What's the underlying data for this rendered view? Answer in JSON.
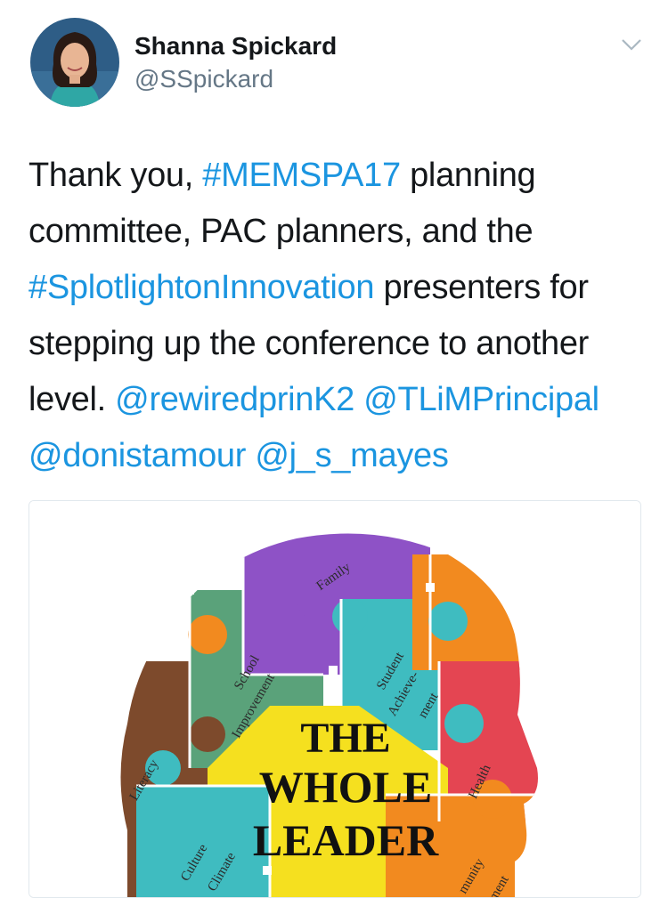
{
  "user": {
    "name": "Shanna Spickard",
    "handle": "@SSpickard"
  },
  "tweet": {
    "t1": "Thank you, ",
    "h1": "#MEMSPA17",
    "t2": " planning",
    "t3": "committee, PAC planners, and the",
    "h2": "#SplotlightonInnovation",
    "t4": " presenters for",
    "t5": "stepping up the conference to another",
    "t6": "level. ",
    "m1": "@rewiredprinK2",
    "m2": "@TLiMPrincipal",
    "m3": "@donistamour",
    "m4": "@j_s_mayes"
  },
  "image": {
    "pieces": {
      "family": "Family",
      "school": "School",
      "improvement": "Improvement",
      "student": "Student",
      "achieve": "Achieve-",
      "ment": "ment",
      "literacy": "Literacy",
      "health": "Health",
      "culture": "Culture",
      "climate": "Climate",
      "community": "munity",
      "ent": "ment"
    },
    "title": {
      "line1": "THE",
      "line2": "WHOLE",
      "line3": "LEADER"
    }
  },
  "colors": {
    "link": "#1b95e0",
    "purple": "#8e52c6",
    "green": "#5aa27a",
    "teal": "#3fbcc0",
    "orange": "#f28a1f",
    "red": "#e44552",
    "brown": "#7d4a2c",
    "yellow": "#f5e01f"
  },
  "icons": {
    "menu": "chevron-down-icon"
  }
}
